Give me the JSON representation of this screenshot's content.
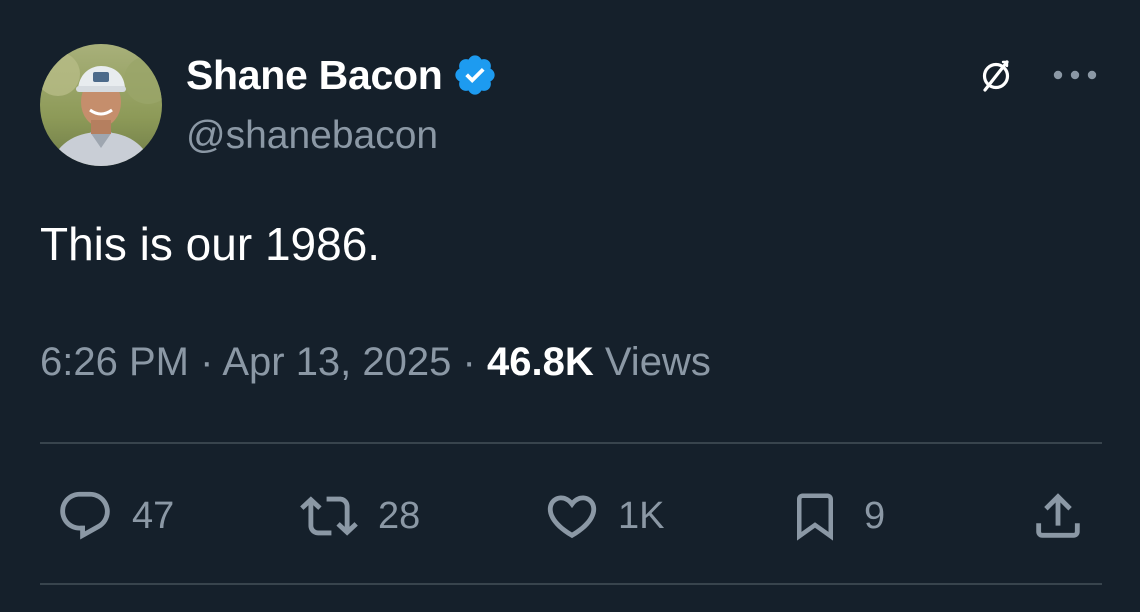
{
  "author": {
    "name": "Shane Bacon",
    "handle": "@shanebacon",
    "verified_color": "#1d9bf0"
  },
  "tweet": {
    "text": "This is our 1986.",
    "time": "6:26 PM",
    "separator": "·",
    "date": "Apr 13, 2025",
    "views_count": "46.8K",
    "views_label": "Views"
  },
  "actions": {
    "replies": "47",
    "reposts": "28",
    "likes": "1K",
    "bookmarks": "9"
  },
  "icons": [
    "verified-badge-icon",
    "grok-icon",
    "more-icon",
    "reply-icon",
    "repost-icon",
    "like-icon",
    "bookmark-icon",
    "share-icon"
  ],
  "colors": {
    "background": "#15202b",
    "text_primary": "#ffffff",
    "text_secondary": "#8b98a5",
    "divider": "#38444d"
  }
}
